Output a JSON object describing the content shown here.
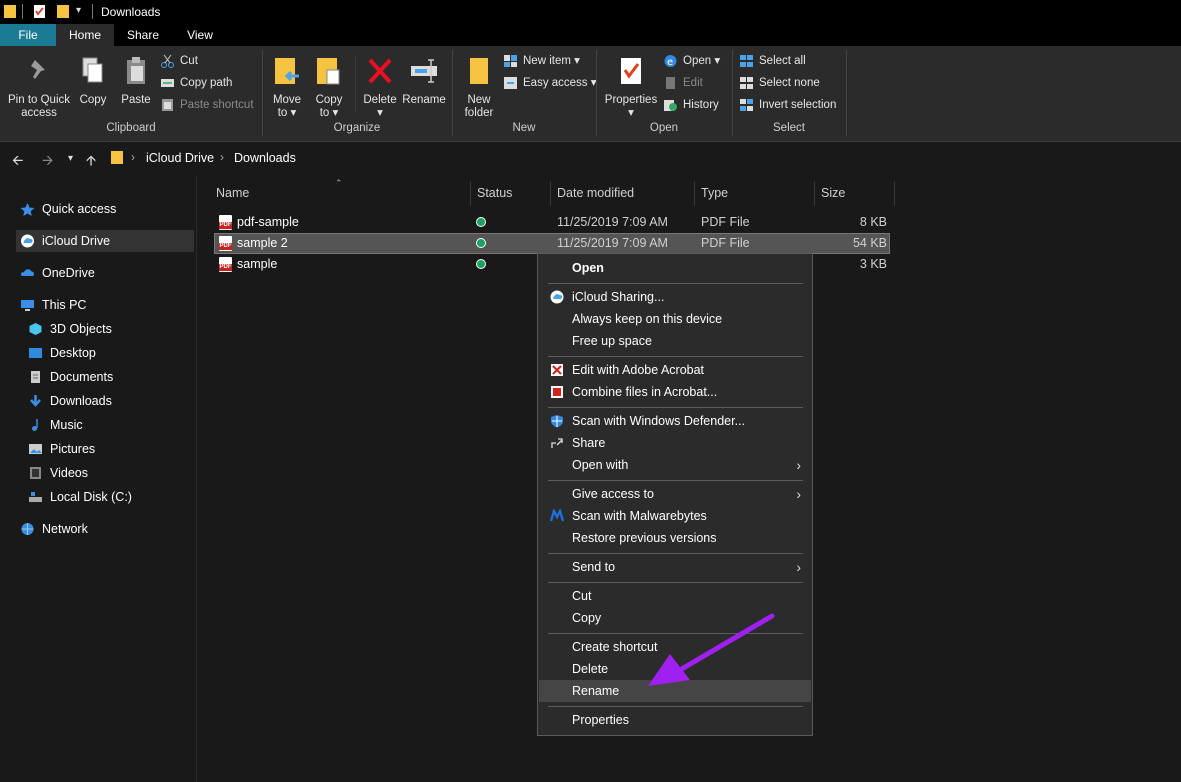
{
  "window": {
    "title": "Downloads"
  },
  "tabs": [
    {
      "label": "File"
    },
    {
      "label": "Home"
    },
    {
      "label": "Share"
    },
    {
      "label": "View"
    }
  ],
  "ribbon": {
    "clipboard": {
      "pin": "Pin to Quick",
      "pin2": "access",
      "copy": "Copy",
      "paste": "Paste",
      "cut": "Cut",
      "copy_path": "Copy path",
      "paste_shortcut": "Paste shortcut",
      "label": "Clipboard"
    },
    "organize": {
      "move_to": "Move",
      "move_to2": "to ▾",
      "copy_to": "Copy",
      "copy_to2": "to ▾",
      "delete": "Delete",
      "delete2": "▾",
      "rename": "Rename",
      "label": "Organize"
    },
    "new": {
      "new_folder": "New",
      "new_folder2": "folder",
      "new_item": "New item ▾",
      "easy_access": "Easy access ▾",
      "label": "New"
    },
    "open": {
      "properties": "Properties",
      "properties2": "▾",
      "open": "Open ▾",
      "edit": "Edit",
      "history": "History",
      "label": "Open"
    },
    "select": {
      "select_all": "Select all",
      "select_none": "Select none",
      "invert": "Invert selection",
      "label": "Select"
    }
  },
  "address": {
    "crumbs": [
      "iCloud Drive",
      "Downloads"
    ],
    "sep": "›"
  },
  "nav": {
    "items": [
      {
        "label": "Quick access"
      },
      {
        "label": "iCloud Drive"
      },
      {
        "label": "OneDrive"
      },
      {
        "label": "This PC"
      },
      {
        "label": "3D Objects"
      },
      {
        "label": "Desktop"
      },
      {
        "label": "Documents"
      },
      {
        "label": "Downloads"
      },
      {
        "label": "Music"
      },
      {
        "label": "Pictures"
      },
      {
        "label": "Videos"
      },
      {
        "label": "Local Disk (C:)"
      },
      {
        "label": "Network"
      }
    ]
  },
  "files": {
    "columns": [
      "Name",
      "Status",
      "Date modified",
      "Type",
      "Size"
    ],
    "rows": [
      {
        "name": "pdf-sample",
        "date": "11/25/2019 7:09 AM",
        "type": "PDF File",
        "size": "8 KB"
      },
      {
        "name": "sample 2",
        "date": "11/25/2019 7:09 AM",
        "type": "PDF File",
        "size": "54 KB"
      },
      {
        "name": "sample",
        "date": "",
        "type": "",
        "size": "3 KB"
      }
    ]
  },
  "context_menu": {
    "items": [
      {
        "label": "Open"
      },
      {
        "label": "iCloud Sharing..."
      },
      {
        "label": "Always keep on this device"
      },
      {
        "label": "Free up space"
      },
      {
        "label": "Edit with Adobe Acrobat"
      },
      {
        "label": "Combine files in Acrobat..."
      },
      {
        "label": "Scan with Windows Defender..."
      },
      {
        "label": "Share"
      },
      {
        "label": "Open with"
      },
      {
        "label": "Give access to"
      },
      {
        "label": "Scan with Malwarebytes"
      },
      {
        "label": "Restore previous versions"
      },
      {
        "label": "Send to"
      },
      {
        "label": "Cut"
      },
      {
        "label": "Copy"
      },
      {
        "label": "Create shortcut"
      },
      {
        "label": "Delete"
      },
      {
        "label": "Rename"
      },
      {
        "label": "Properties"
      }
    ]
  },
  "colors": {
    "accent": "#1b7b95",
    "arrow": "#a020f0",
    "folder": "#f5c242"
  }
}
